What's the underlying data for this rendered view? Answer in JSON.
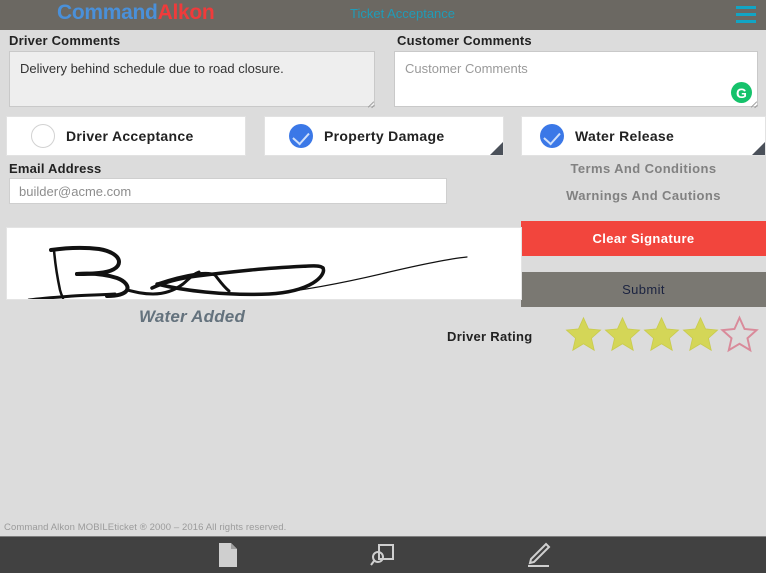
{
  "header": {
    "logo_primary": "Command",
    "logo_secondary": "Alkon",
    "title": "Ticket Acceptance",
    "menu_icon": "hamburger-menu-icon",
    "accent_color": "#12a5c4",
    "bg_color": "#6b6862"
  },
  "comments": {
    "driver_label": "Driver Comments",
    "driver_value": "Delivery behind schedule due to road closure.",
    "customer_label": "Customer Comments",
    "customer_value": "",
    "customer_placeholder": "Customer Comments",
    "grammarly_icon_letter": "G",
    "grammarly_color": "#15c26b"
  },
  "checkboxes": [
    {
      "label": "Driver Acceptance",
      "checked": false
    },
    {
      "label": "Property Damage",
      "checked": true
    },
    {
      "label": "Water Release",
      "checked": true
    }
  ],
  "email": {
    "label": "Email Address",
    "value": "",
    "placeholder": "builder@acme.com"
  },
  "links": {
    "terms": "Terms And Conditions",
    "warnings": "Warnings And Cautions"
  },
  "buttons": {
    "clear_signature": "Clear Signature",
    "clear_signature_color": "#f2453d",
    "submit": "Submit",
    "submit_color": "#7a7872"
  },
  "signature": {
    "caption": "Water Added",
    "caption_color": "#64727d",
    "stroke_color": "#111111"
  },
  "rating": {
    "label": "Driver Rating",
    "value": 4,
    "max": 5,
    "filled_color": "#d4d657",
    "empty_outline_color": "#d98a9a"
  },
  "footer": {
    "copyright": "Command Alkon MOBILEticket ® 2000 – 2016 All rights reserved."
  },
  "bottom_nav": [
    {
      "icon": "document-page-icon"
    },
    {
      "icon": "ticket-search-icon"
    },
    {
      "icon": "pen-signature-icon"
    }
  ]
}
